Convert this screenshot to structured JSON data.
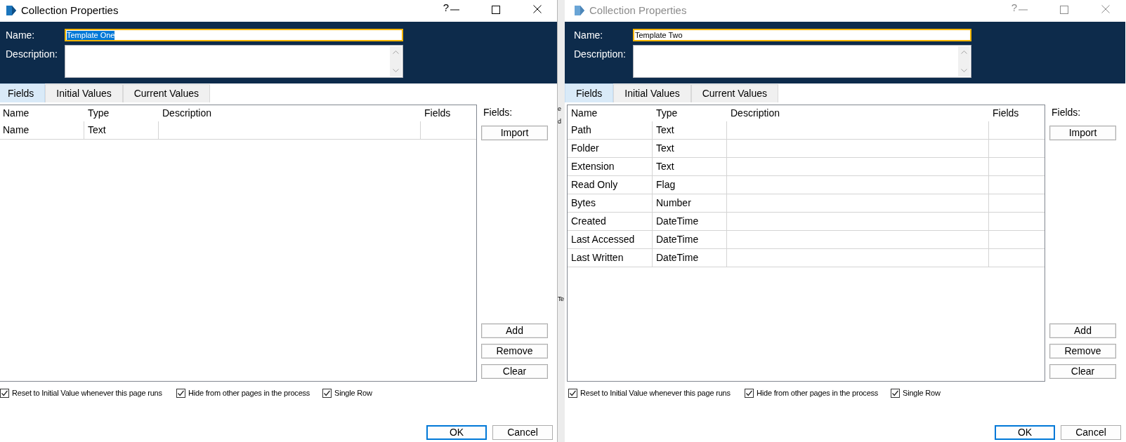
{
  "windows": [
    {
      "title": "Collection Properties",
      "active": true,
      "help": "?",
      "name": {
        "label": "Name:",
        "value": "Template One",
        "highlighted": true
      },
      "description": {
        "label": "Description:"
      },
      "tabs": [
        {
          "label": "Fields",
          "selected": true
        },
        {
          "label": "Initial Values",
          "selected": false
        },
        {
          "label": "Current Values",
          "selected": false
        }
      ],
      "table": {
        "columns": [
          "Name",
          "Type",
          "Description",
          "Fields"
        ],
        "rows": [
          [
            "Name",
            "Text"
          ]
        ]
      },
      "fields_panel": {
        "label": "Fields:",
        "import_button": "Import",
        "actions": [
          "Add",
          "Remove",
          "Clear"
        ]
      },
      "options": [
        {
          "label": "Reset to Initial Value whenever this page runs",
          "checked": true
        },
        {
          "label": "Hide from other pages in the process",
          "checked": true
        },
        {
          "label": "Single Row",
          "checked": true
        }
      ],
      "buttons": [
        {
          "label": "OK",
          "default": true
        },
        {
          "label": "Cancel",
          "default": false
        }
      ]
    },
    {
      "title": "Collection Properties",
      "active": false,
      "help": "?",
      "name": {
        "label": "Name:",
        "value": "Template Two",
        "highlighted": false
      },
      "description": {
        "label": "Description:"
      },
      "tabs": [
        {
          "label": "Fields",
          "selected": true
        },
        {
          "label": "Initial Values",
          "selected": false
        },
        {
          "label": "Current Values",
          "selected": false
        }
      ],
      "table": {
        "columns": [
          "Name",
          "Type",
          "Description",
          "Fields"
        ],
        "rows": [
          [
            "Path",
            "Text"
          ],
          [
            "Folder",
            "Text"
          ],
          [
            "Extension",
            "Text"
          ],
          [
            "Read Only",
            "Flag"
          ],
          [
            "Bytes",
            "Number"
          ],
          [
            "Created",
            "DateTime"
          ],
          [
            "Last Accessed",
            "DateTime"
          ],
          [
            "Last Written",
            "DateTime"
          ]
        ]
      },
      "fields_panel": {
        "label": "Fields:",
        "import_button": "Import",
        "actions": [
          "Add",
          "Remove",
          "Clear"
        ]
      },
      "options": [
        {
          "label": "Reset to Initial Value whenever this page runs",
          "checked": true
        },
        {
          "label": "Hide from other pages in the process",
          "checked": true
        },
        {
          "label": "Single Row",
          "checked": true
        }
      ],
      "buttons": [
        {
          "label": "OK",
          "default": true
        },
        {
          "label": "Cancel",
          "default": false
        }
      ]
    }
  ],
  "background_window": {
    "fragments": [
      "e",
      "d",
      "Te"
    ]
  }
}
